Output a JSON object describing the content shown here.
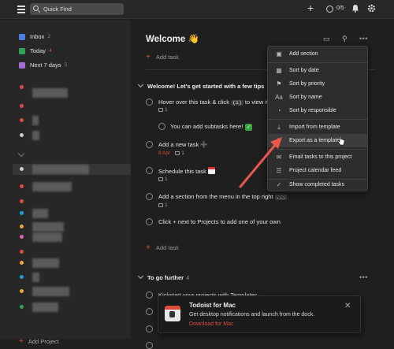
{
  "topbar": {
    "search_placeholder": "Quick Find",
    "karma": "0/5"
  },
  "sidebar": {
    "items": [
      {
        "label": "Inbox",
        "count": "2",
        "color": "#4c7ee3"
      },
      {
        "label": "Today",
        "count": "4",
        "color": "#2fa353"
      },
      {
        "label": "Next 7 days",
        "count": "5",
        "color": "#a46dd6"
      }
    ],
    "project_colors": [
      "#dc4c3e",
      "#dc4c3e",
      "#dc4c3e",
      "#cccccc",
      "#cccccc",
      "#dc4c3e",
      "#dc4c3e",
      "#1f9cd8",
      "#f0a53a",
      "#e05fb7",
      "#dc4c3e",
      "#f0a53a",
      "#1f9cd8",
      "#f0a53a",
      "#2fa353"
    ],
    "add_project": "Add Project"
  },
  "main": {
    "title": "Welcome 👋",
    "add_task": "Add task",
    "section1": {
      "title": "Welcome! Let's get started with a few tips",
      "tasks": [
        {
          "text_a": "Hover over this task & click ",
          "kbd": "(i)",
          "text_b": " to view it",
          "comments": "1"
        },
        {
          "text": "You can add subtasks here!"
        },
        {
          "text": "Add a new task ➕",
          "date": "8 Apr",
          "comments": "1"
        },
        {
          "text": "Schedule this task",
          "comments": "1"
        },
        {
          "text": "Add a section from the menu in the top right ",
          "kbd": "...",
          "comments": "1"
        },
        {
          "text": "Click + next to Projects to add one of your own"
        }
      ],
      "add_task": "Add task"
    },
    "section2": {
      "title": "To go further",
      "count": "4",
      "tasks": [
        {
          "text": "Kickstart your projects with Templates →"
        }
      ]
    }
  },
  "menu": {
    "items": [
      {
        "icon": "▣",
        "label": "Add section"
      },
      {
        "icon": "▦",
        "label": "Sort by date"
      },
      {
        "icon": "⚑",
        "label": "Sort by priority"
      },
      {
        "icon": "Aa",
        "label": "Sort by name"
      },
      {
        "icon": "◔",
        "label": "Sort by responsible"
      },
      {
        "icon": "⤓",
        "label": "Import from template"
      },
      {
        "icon": "⤒",
        "label": "Export as a template"
      },
      {
        "icon": "✉",
        "label": "Email tasks to this project"
      },
      {
        "icon": "☰",
        "label": "Project calendar feed"
      },
      {
        "icon": "✓",
        "label": "Show completed tasks"
      }
    ]
  },
  "toast": {
    "title": "Todoist for Mac",
    "message": "Get desktop notifications and launch from the dock.",
    "link": "Download for Mac"
  },
  "colors": {
    "accent": "#dc4c3e",
    "arrow": "#e8574a"
  }
}
